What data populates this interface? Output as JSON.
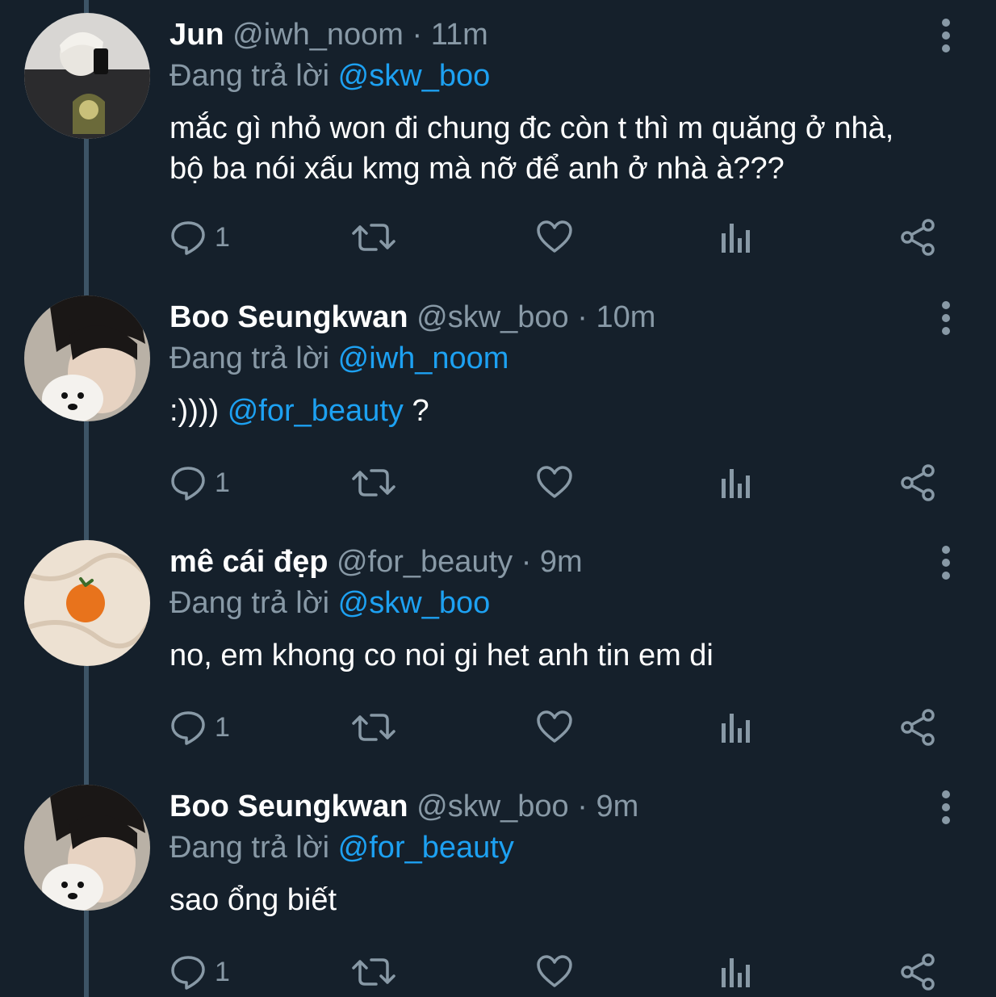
{
  "tweets": [
    {
      "name": "Jun",
      "handle": "@iwh_noom",
      "dot": "·",
      "time": "11m",
      "replying_prefix": "Đang trả lời",
      "replying_to": "@skw_boo",
      "text": "mắc gì nhỏ won đi chung đc còn t thì m quăng ở nhà, bộ ba nói xấu kmg mà nỡ để anh ở nhà à???",
      "reply_count": "1"
    },
    {
      "name": "Boo Seungkwan",
      "handle": "@skw_boo",
      "dot": "·",
      "time": "10m",
      "replying_prefix": "Đang trả lời",
      "replying_to": "@iwh_noom",
      "text_before": ":)))) ",
      "text_mention": "@for_beauty",
      "text_after": " ?",
      "reply_count": "1"
    },
    {
      "name": "mê cái đẹp",
      "handle": "@for_beauty",
      "dot": "·",
      "time": "9m",
      "replying_prefix": "Đang trả lời",
      "replying_to": "@skw_boo",
      "text": "no, em khong co noi gi het anh tin em di",
      "reply_count": "1"
    },
    {
      "name": "Boo Seungkwan",
      "handle": "@skw_boo",
      "dot": "·",
      "time": "9m",
      "replying_prefix": "Đang trả lời",
      "replying_to": "@for_beauty",
      "text": "sao ổng biết",
      "reply_count": "1"
    }
  ],
  "icons": {
    "reply": "reply-icon",
    "retweet": "retweet-icon",
    "like": "like-icon",
    "stats": "stats-icon",
    "share": "share-icon",
    "more": "more-options-icon"
  },
  "colors": {
    "background": "#15202b",
    "text": "#ffffff",
    "muted": "#8899a6",
    "link": "#1da1f2",
    "thread_line": "#3d5466"
  }
}
